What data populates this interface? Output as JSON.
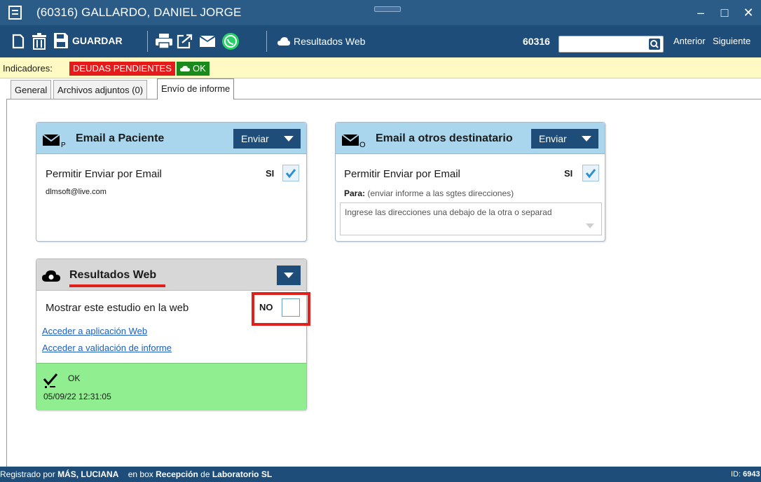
{
  "window": {
    "title": "(60316) GALLARDO, DANIEL JORGE",
    "minimize": "–",
    "maximize": "□",
    "close": "✕"
  },
  "toolbar": {
    "save_label": "GUARDAR",
    "results_web_label": "Resultados Web",
    "patient_id": "60316",
    "search_value": "",
    "prev_label": "Anterior",
    "next_label": "Siguiente"
  },
  "indicators": {
    "label": "Indicadores:",
    "debts_badge": "DEUDAS PENDIENTES",
    "ok_badge": "OK"
  },
  "tabs": [
    {
      "label": "General",
      "active": false
    },
    {
      "label": "Archivos adjuntos (0)",
      "active": false
    },
    {
      "label": "Envío de informe",
      "active": true
    }
  ],
  "email_patient": {
    "title": "Email a Paciente",
    "icon_suffix": "P",
    "send_label": "Enviar",
    "allow_label": "Permitir Enviar por Email",
    "allow_value": "SI",
    "email": "dlmsoft@live.com"
  },
  "email_others": {
    "title": "Email a otros destinatario",
    "icon_suffix": "O",
    "send_label": "Enviar",
    "allow_label": "Permitir Enviar por Email",
    "allow_value": "SI",
    "para_label": "Para:",
    "para_hint": "(enviar informe a las sgtes direcciones)",
    "addresses_placeholder": "Ingrese las direcciones una debajo de la otra o separad"
  },
  "web_results": {
    "title": "Resultados Web",
    "show_label": "Mostrar este estudio en la web",
    "show_value": "NO",
    "link_app": "Acceder a aplicación Web",
    "link_validation": "Acceder a validación de informe",
    "status": "OK",
    "status_time": "05/09/22 12:31:05"
  },
  "statusbar": {
    "registered_by_label": "Registrado por",
    "registered_by": "MÁS, LUCIANA",
    "box_label": "en box",
    "box": "Recepción",
    "lab_label": "de",
    "lab": "Laboratorio SL",
    "id_label": "ID:",
    "id_value": "6943"
  },
  "colors": {
    "titlebar": "#2b5c88",
    "toolbar": "#1d4d78",
    "card_header": "#a9d6ec",
    "success": "#90ee90",
    "danger": "#e31b1b",
    "ok_green": "#1a8a1a",
    "highlight": "#e0201c"
  }
}
